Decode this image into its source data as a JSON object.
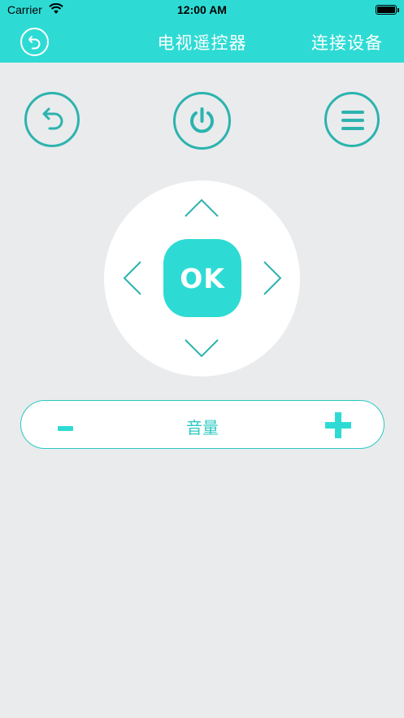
{
  "status_bar": {
    "carrier": "Carrier",
    "time": "12:00 AM",
    "icons": [
      "wifi-icon",
      "battery-icon"
    ]
  },
  "nav": {
    "back_icon": "back-circle-icon",
    "title": "电视遥控器",
    "right_label": "连接设备"
  },
  "controls": {
    "back_icon": "return-arrow-icon",
    "power_icon": "power-icon",
    "menu_icon": "menu-icon"
  },
  "dpad": {
    "ok_label": "OK",
    "up_icon": "chevron-up-icon",
    "down_icon": "chevron-down-icon",
    "left_icon": "chevron-left-icon",
    "right_icon": "chevron-right-icon"
  },
  "volume": {
    "label": "音量",
    "minus_icon": "minus-icon",
    "plus_icon": "plus-icon"
  },
  "colors": {
    "accent": "#2edbd4",
    "accent_dark": "#2cb3ae",
    "background": "#e9ebed",
    "white": "#ffffff"
  }
}
